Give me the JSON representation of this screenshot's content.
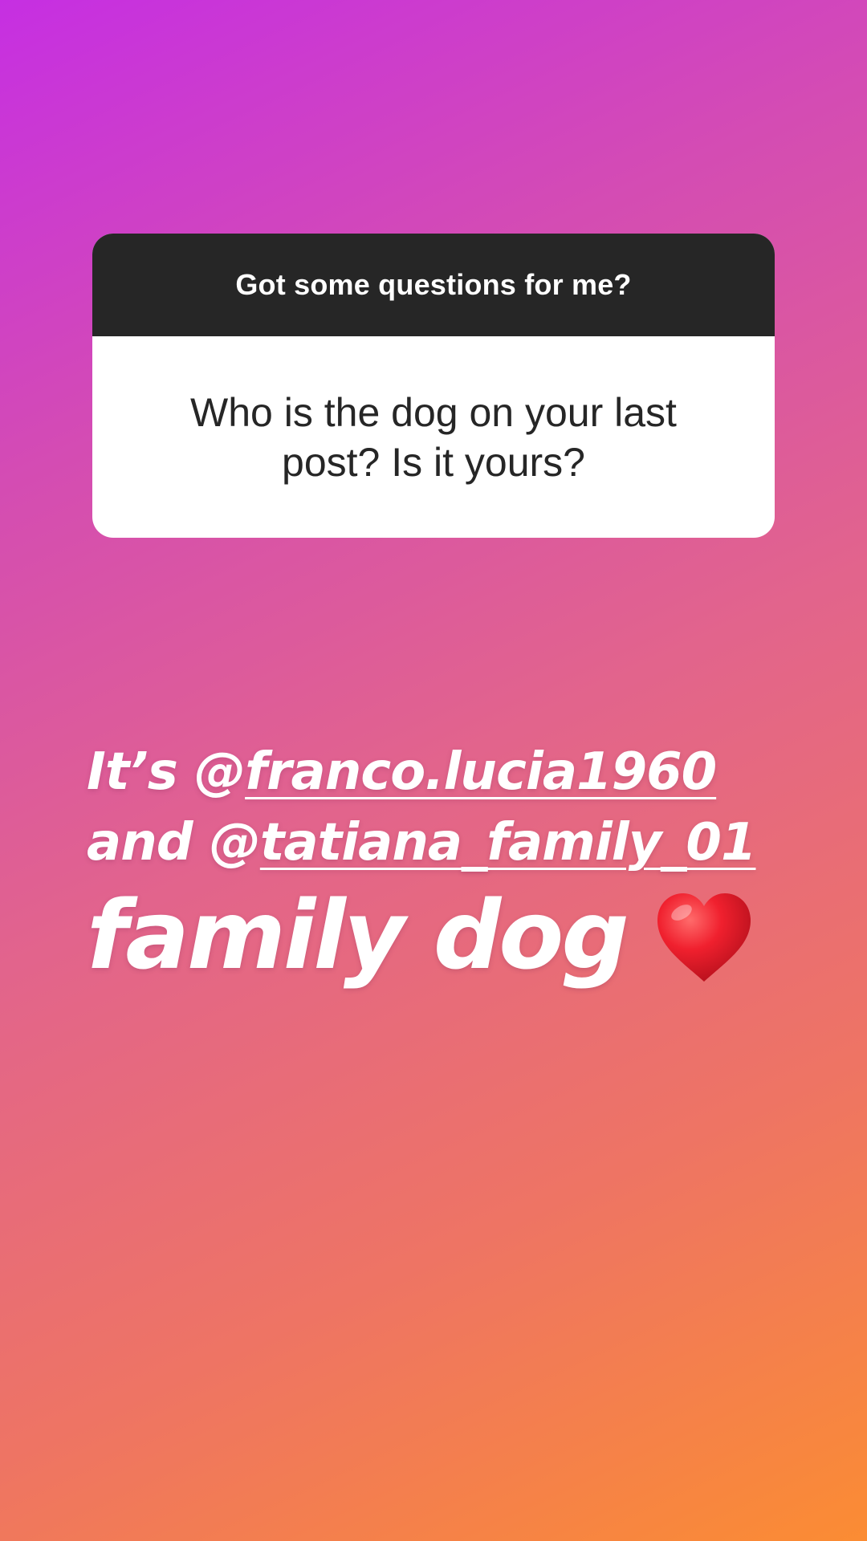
{
  "question_sticker": {
    "prompt": "Got some questions for me?",
    "question": "Who is the dog on your last post? Is it yours?"
  },
  "answer": {
    "line1_prefix": "It’s @",
    "line1_mention": "franco.lucia1960",
    "line2_prefix": "and @",
    "line2_mention": "tatiana_family_01",
    "line3": "family dog",
    "emoji": "heart-icon"
  },
  "colors": {
    "gradient_start": "#c62fe2",
    "gradient_end": "#fb8c33",
    "sticker_header": "#262626",
    "sticker_body": "#ffffff",
    "heart": "#e8192c"
  }
}
